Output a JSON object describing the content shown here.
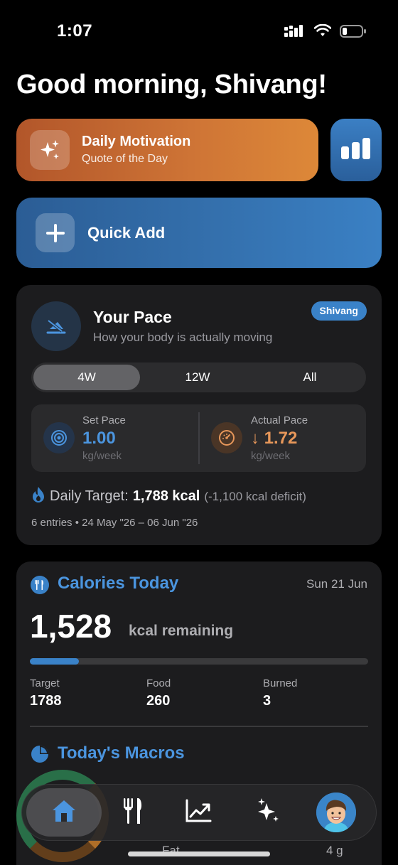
{
  "status_bar": {
    "time": "1:07",
    "icons": [
      "cellular-icon",
      "wifi-icon",
      "battery-icon"
    ]
  },
  "greeting": "Good morning, Shivang!",
  "motivation": {
    "title": "Daily Motivation",
    "subtitle": "Quote of the Day",
    "icon": "sparkles-icon"
  },
  "stats_button": {
    "icon": "bar-chart-icon"
  },
  "quick_add": {
    "label": "Quick Add",
    "icon": "plus-icon"
  },
  "pace": {
    "title": "Your Pace",
    "subtitle": "How your body is actually moving",
    "user_badge": "Shivang",
    "ranges": [
      "4W",
      "12W",
      "All"
    ],
    "selected_range": "4W",
    "set_pace": {
      "label": "Set Pace",
      "value": "1.00",
      "unit": "kg/week"
    },
    "actual_pace": {
      "label": "Actual Pace",
      "value": "↓ 1.72",
      "unit": "kg/week"
    },
    "daily_target_label": "Daily Target:",
    "daily_target_value": "1,788 kcal",
    "deficit": "(-1,100 kcal deficit)",
    "entries": "6 entries • 24 May \"26 – 06 Jun \"26"
  },
  "calories": {
    "title": "Calories Today",
    "date": "Sun 21 Jun",
    "remaining_value": "1,528",
    "remaining_label": "kcal remaining",
    "progress_fraction": 0.145,
    "target_label": "Target",
    "target_value": "1788",
    "food_label": "Food",
    "food_value": "260",
    "burned_label": "Burned",
    "burned_value": "3"
  },
  "macros": {
    "title": "Today's Macros",
    "visible_row_label": "Fat",
    "visible_row_value": "4 g"
  },
  "tab_bar": {
    "tabs": [
      "home-icon",
      "fork-knife-icon",
      "trend-chart-icon",
      "sparkles-icon",
      "profile-avatar"
    ],
    "active": "home-icon"
  },
  "colors": {
    "accent_blue": "#3a82c8",
    "accent_orange": "#dd8838",
    "card_bg": "#1c1c1e"
  }
}
